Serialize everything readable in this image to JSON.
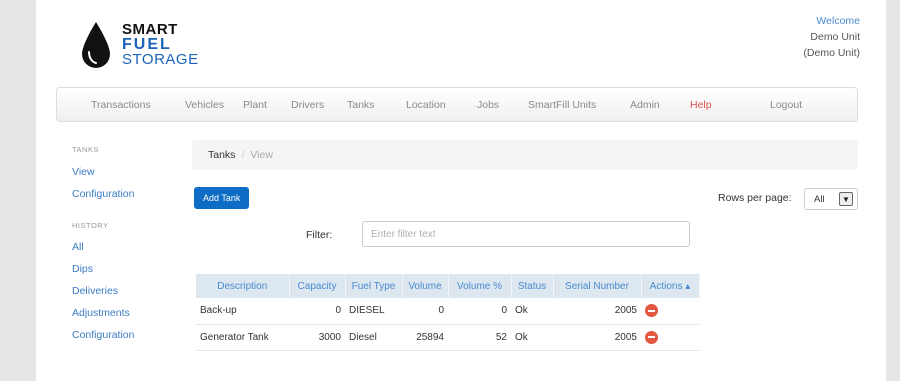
{
  "logo": {
    "line1": "SMART",
    "line2": "FUEL",
    "line3": "STORAGE"
  },
  "user": {
    "welcome": "Welcome",
    "name": "Demo Unit",
    "sub": "(Demo Unit)"
  },
  "nav": [
    {
      "label": "Transactions"
    },
    {
      "label": "Vehicles"
    },
    {
      "label": "Plant"
    },
    {
      "label": "Drivers"
    },
    {
      "label": "Tanks"
    },
    {
      "label": "Location"
    },
    {
      "label": "Jobs"
    },
    {
      "label": "SmartFill Units"
    },
    {
      "label": "Admin"
    },
    {
      "label": "Help"
    },
    {
      "label": "Logout"
    }
  ],
  "sidebar": {
    "tanks_heading": "TANKS",
    "tanks_links": [
      "View",
      "Configuration"
    ],
    "history_heading": "HISTORY",
    "history_links": [
      "All",
      "Dips",
      "Deliveries",
      "Adjustments",
      "Configuration"
    ]
  },
  "breadcrumb": {
    "parent": "Tanks",
    "separator": "/",
    "current": "View"
  },
  "add_button": "Add Tank",
  "rows_per_page": {
    "label": "Rows per page:",
    "value": "All"
  },
  "filter": {
    "label": "Filter:",
    "placeholder": "Enter filter text",
    "value": ""
  },
  "table": {
    "headers": [
      "Description",
      "Capacity",
      "Fuel Type",
      "Volume",
      "Volume %",
      "Status",
      "Serial Number",
      "Actions ▴"
    ],
    "rows": [
      [
        "Back-up",
        "0",
        "DIESEL",
        "0",
        "0",
        "Ok",
        "2005"
      ],
      [
        "Generator Tank",
        "3000",
        "Diesel",
        "25894",
        "52",
        "Ok",
        "2005"
      ]
    ]
  },
  "colors": {
    "accent": "#0d6cc4",
    "link": "#3c7cc4",
    "help": "#d9534f",
    "delete": "#e2573f",
    "table_header_bg": "#dce7f0"
  }
}
